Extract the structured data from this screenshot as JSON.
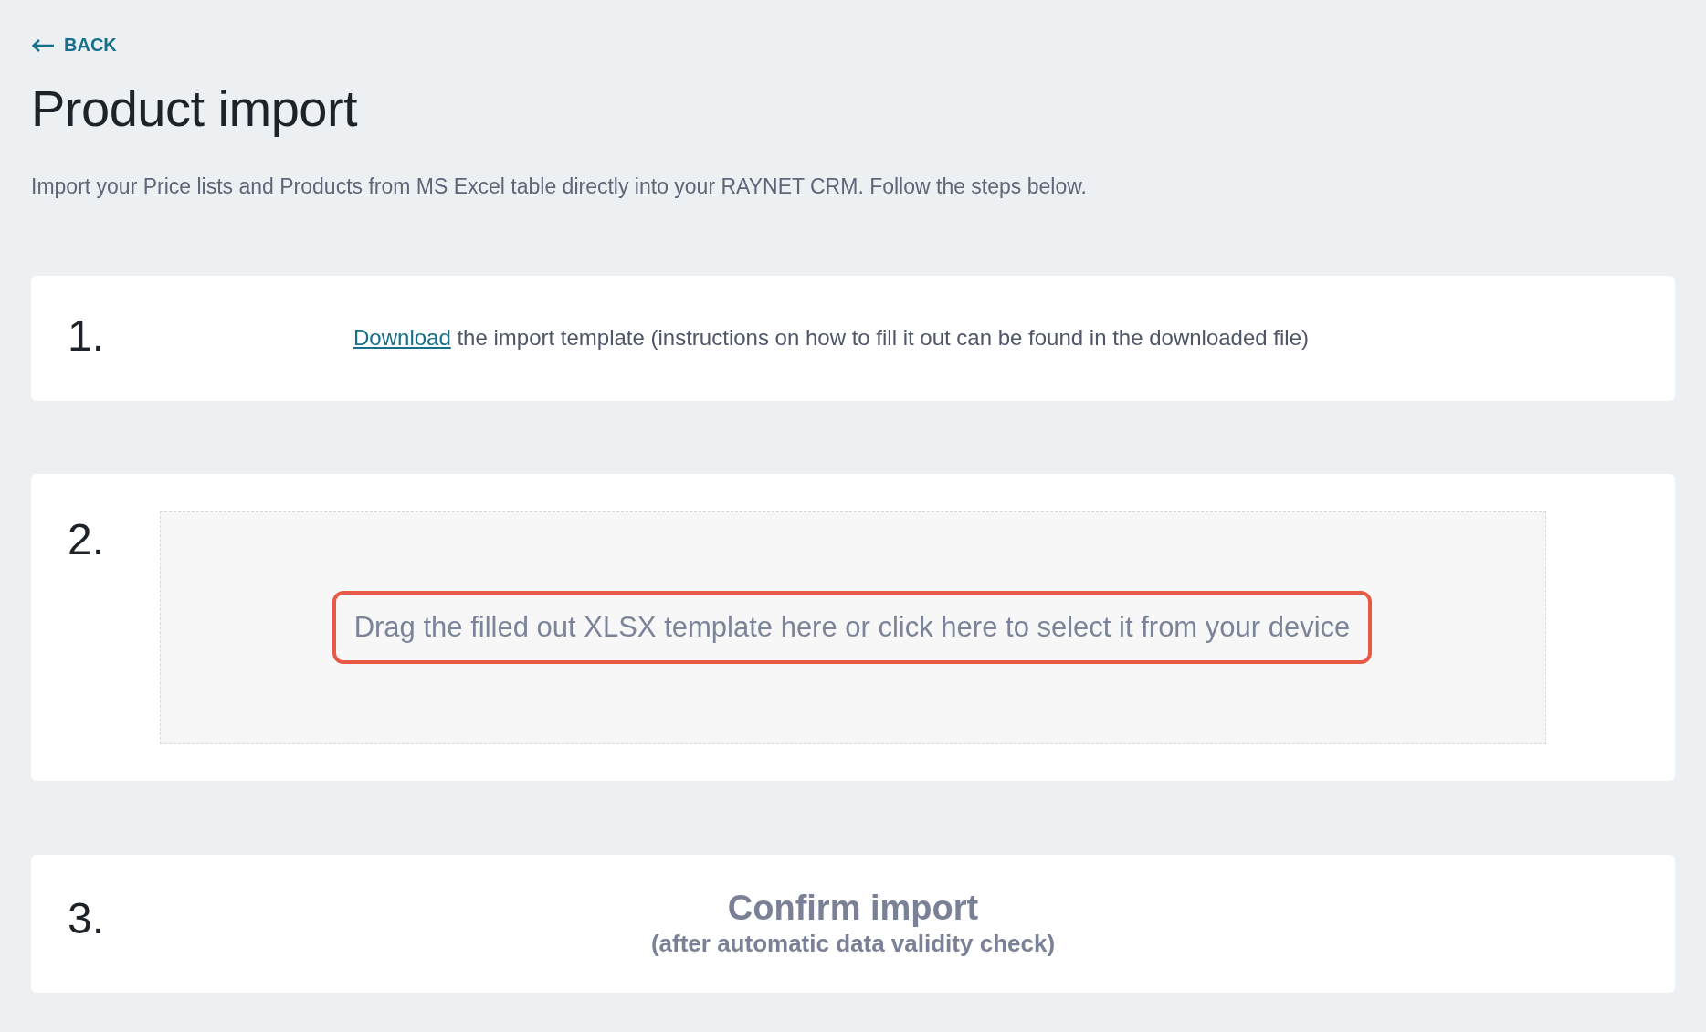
{
  "back_link": {
    "label": "BACK"
  },
  "title": "Product import",
  "description": "Import your Price lists and Products from MS Excel table directly into your RAYNET CRM. Follow the steps below.",
  "steps": [
    {
      "kind": "download",
      "number": "1.",
      "link": "Download",
      "text": "the import template (instructions on how to fill it out can be found in the downloaded file)"
    },
    {
      "kind": "dropzone",
      "number": "2.",
      "text": "Drag the filled out XLSX template here or click here to select it from your device",
      "highlighted": true
    },
    {
      "kind": "confirm",
      "number": "3.",
      "text": "Confirm import",
      "subtext": "(after automatic data validity check)"
    }
  ]
}
